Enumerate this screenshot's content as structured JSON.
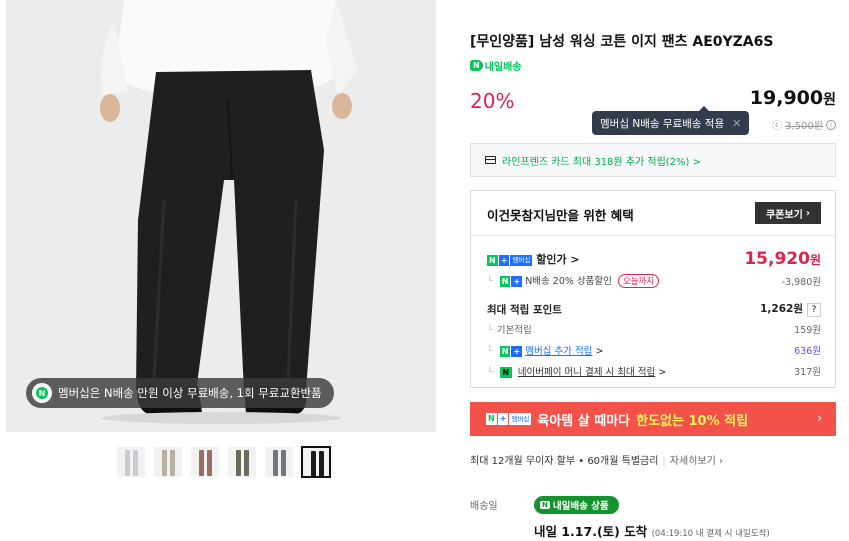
{
  "product": {
    "title": "[무인양품] 남성 워싱 코튼 이지 팬츠 AE0YZA6S",
    "tomorrow_tag": "내일배송",
    "discount": "20%",
    "price": "19,900",
    "price_unit": "원",
    "tooltip": "멤버십 N배송 무료배송 적용",
    "tooltip_close": "✕",
    "shipping_original": "3,500원",
    "shipping_prefix": "ⓒ"
  },
  "photo": {
    "badge_text": "멤버십은 N배송 만원 이상 무료배송, 1회 무료교환반품"
  },
  "thumbnails": [
    {
      "color": "#c8ccd2"
    },
    {
      "color": "#b8b0a0"
    },
    {
      "color": "#9a6e64"
    },
    {
      "color": "#6a6a5a"
    },
    {
      "color": "#707880"
    },
    {
      "color": "#1a1a1a",
      "active": true
    }
  ],
  "card_benefit": "라인프렌즈 카드 최대 318원 추가 적립(2%) >",
  "benefit": {
    "heading": "이건못참지님만을 위한 혜택",
    "coupon_button": "쿠폰보기",
    "coupon_arrow": "›",
    "sale_label": "할인가 >",
    "sale_price": "15,920",
    "sale_unit": "원",
    "nsale_label": "N배송 20% 상품할인",
    "today_badge": "오늘까지",
    "nsale_value": "-3,980원",
    "points_label": "최대 적립 포인트",
    "points_value": "1,262원",
    "points_help": "?",
    "basic_label": "기본적립",
    "basic_value": "159원",
    "member_label": "멤버십 추가 적립",
    "member_arrow": ">",
    "member_value": "636원",
    "npay_label": "네이버페이 머니 결제 시 최대 적립",
    "npay_arrow": ">",
    "npay_value": "317원",
    "npay_n": "N",
    "badge_n": "N",
    "badge_plus": "+",
    "badge_member": "멤버십"
  },
  "banner": {
    "text_main": "육아템 살 때마다",
    "text_highlight": "한도없는 10% 적립",
    "arrow": "›"
  },
  "installment": {
    "text": "최대 12개월 무이자 할부 • 60개월 특별금리",
    "link": "자세히보기 ›"
  },
  "shipping": {
    "label": "배송일",
    "pill": "내일배송 상품",
    "date": "내일 1.17.(토) 도착",
    "note": "(04:19:10 내 결제 시 내일도착)"
  },
  "colors": {
    "accent_red": "#e0234e",
    "naver_green": "#03c75a",
    "banner_red": "#f2524a"
  }
}
